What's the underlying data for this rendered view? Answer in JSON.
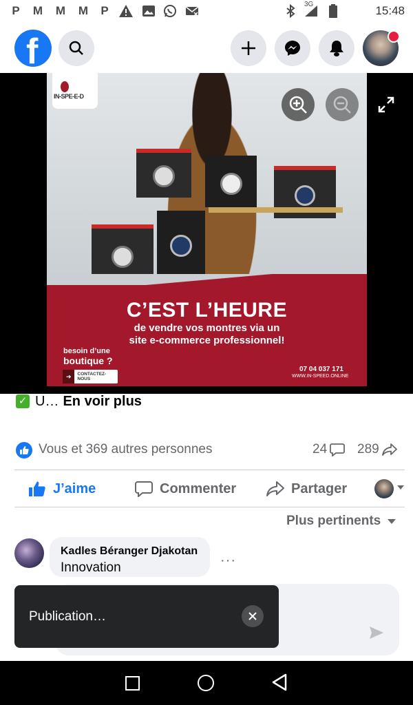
{
  "status_bar": {
    "time": "15:48",
    "network": "3G",
    "notif_icons": [
      "P",
      "M",
      "M",
      "M",
      "P",
      "warning-icon",
      "image-icon",
      "whatsapp-icon",
      "mail-off-icon"
    ]
  },
  "header": {
    "logo": "facebook-logo"
  },
  "ad": {
    "brand": "IN-SPE-E-D",
    "headline": "C’EST L’HEURE",
    "subline1": "de vendre vos montres via un",
    "subline2": "site e-commerce professionnel!",
    "boutique1": "besoin d’une",
    "boutique2": "boutique ?",
    "cta": "CONTACTEZ-NOUS",
    "phone": "07 04 037 171",
    "site": "WWW.IN-SPEED.ONLINE",
    "accent_color": "#a3182a"
  },
  "post": {
    "caption_prefix": "U…",
    "see_more": "En voir plus",
    "reactions_text": "Vous et 369 autres personnes",
    "comments_count": "24",
    "shares_count": "289",
    "like_label": "J’aime",
    "comment_label": "Commenter",
    "share_label": "Partager"
  },
  "comments": {
    "sort_label": "Plus pertinents",
    "items": [
      {
        "author": "Kadles Béranger Djakotan",
        "text": "Innovation"
      }
    ]
  },
  "toast": {
    "text": "Publication…"
  },
  "colors": {
    "facebook_blue": "#1877f2",
    "toast_bg": "#242526"
  }
}
